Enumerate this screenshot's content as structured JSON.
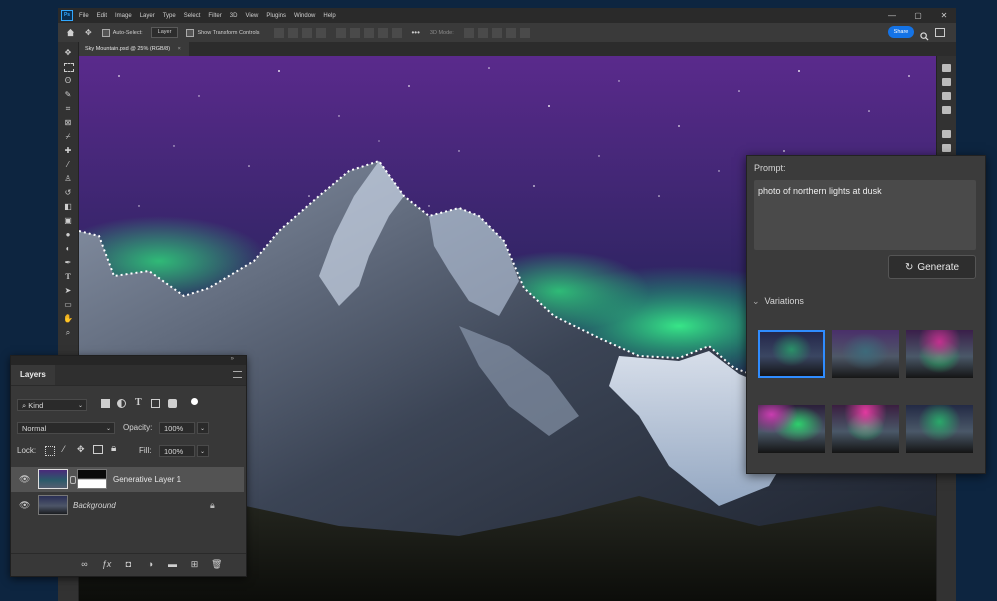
{
  "menu": {
    "app_icon": "Ps",
    "items": [
      "File",
      "Edit",
      "Image",
      "Layer",
      "Type",
      "Select",
      "Filter",
      "3D",
      "View",
      "Plugins",
      "Window",
      "Help"
    ],
    "controls": [
      "—",
      "▢",
      "✕"
    ]
  },
  "options_bar": {
    "auto_select_label": "Auto-Select:",
    "auto_select_value": "Layer",
    "show_transform_label": "Show Transform Controls",
    "mode_3d_label": "3D Mode:",
    "share_label": "Share"
  },
  "document": {
    "tab_title": "Sky Mountain.psd @ 25% (RGB/8)",
    "tab_close": "×"
  },
  "layers_panel": {
    "tab_label": "Layers",
    "filter_kind": "Kind",
    "blend_mode": "Normal",
    "opacity_label": "Opacity:",
    "opacity_value": "100%",
    "lock_label": "Lock:",
    "fill_label": "Fill:",
    "fill_value": "100%",
    "layers": [
      {
        "name": "Generative Layer 1",
        "visible": true,
        "selected": true
      },
      {
        "name": "Background",
        "visible": true,
        "locked": true
      }
    ]
  },
  "generative_panel": {
    "prompt_label": "Prompt:",
    "prompt_text": "photo of northern lights at dusk",
    "generate_label": "Generate",
    "variations_label": "Variations",
    "variations_count": 6,
    "selected_variation": 0
  },
  "colors": {
    "accent": "#1473e6",
    "selected_outline": "#2f8cff",
    "background": "#0d2540"
  }
}
